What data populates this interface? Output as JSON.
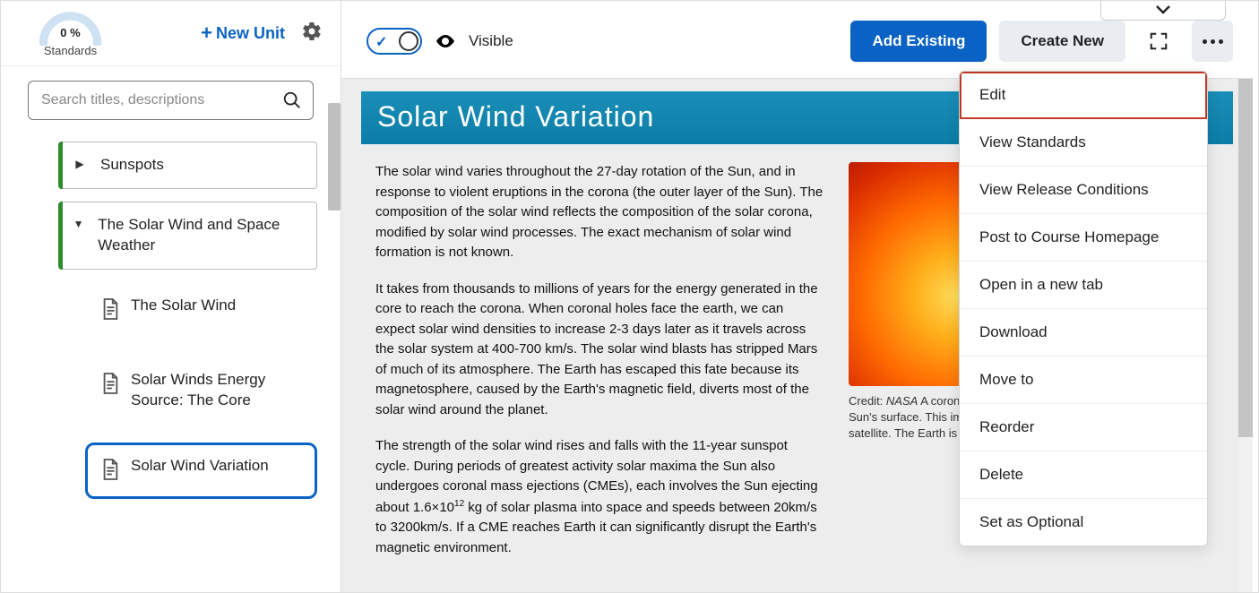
{
  "sidebar": {
    "standards": {
      "percent": "0 %",
      "label": "Standards"
    },
    "newUnit": "New Unit",
    "search": {
      "placeholder": "Search titles, descriptions"
    },
    "units": [
      {
        "title": "Sunspots",
        "expanded": false
      },
      {
        "title": "The Solar Wind and Space Weather",
        "expanded": true
      }
    ],
    "topics": [
      {
        "title": "The Solar Wind",
        "active": false
      },
      {
        "title": "Solar Winds Energy Source: The Core",
        "active": false
      },
      {
        "title": "Solar Wind Variation",
        "active": true
      }
    ]
  },
  "toolbar": {
    "visibleLabel": "Visible",
    "addExisting": "Add Existing",
    "createNew": "Create New"
  },
  "menu": {
    "items": [
      "Edit",
      "View Standards",
      "View Release Conditions",
      "Post to Course Homepage",
      "Open in a new tab",
      "Download",
      "Move to",
      "Reorder",
      "Delete",
      "Set as Optional"
    ]
  },
  "page": {
    "title": "Solar Wind Variation",
    "p1": "The solar wind varies throughout the 27-day rotation of the Sun, and in response to violent eruptions in the corona (the outer layer of the Sun). The composition of the solar wind reflects the composition of the solar corona, modified by solar wind processes. The exact mechanism of solar wind formation is not known.",
    "p2": "It takes from thousands to millions of years for the energy generated in the core to reach the corona. When coronal holes face the earth, we can expect solar wind densities to increase 2-3 days later as it travels across the solar system at 400-700 km/s. The solar wind blasts has stripped Mars of much of its atmosphere. The Earth has escaped this fate because its magnetosphere, caused by the Earth's magnetic field, diverts most of the solar wind around the planet.",
    "p3a": "The strength of the solar wind rises and falls with the 11-year sunspot cycle. During periods of greatest activity  solar maxima  the Sun also undergoes coronal mass ejections (CMEs), each involves the Sun ejecting about 1.6×10",
    "p3sup": "12",
    "p3b": " kg of solar plasma into space and speeds between 20km/s to 3200km/s. If a CME reaches Earth it can significantly disrupt the Earth's magnetic environment.",
    "captionCreditLabel": "Credit: ",
    "captionCreditName": "NASA",
    "captionText": " A coronal mass ejection blasts off the Sun's surface. This image was captured by a NASA satellite. The Earth is shown to scale."
  }
}
